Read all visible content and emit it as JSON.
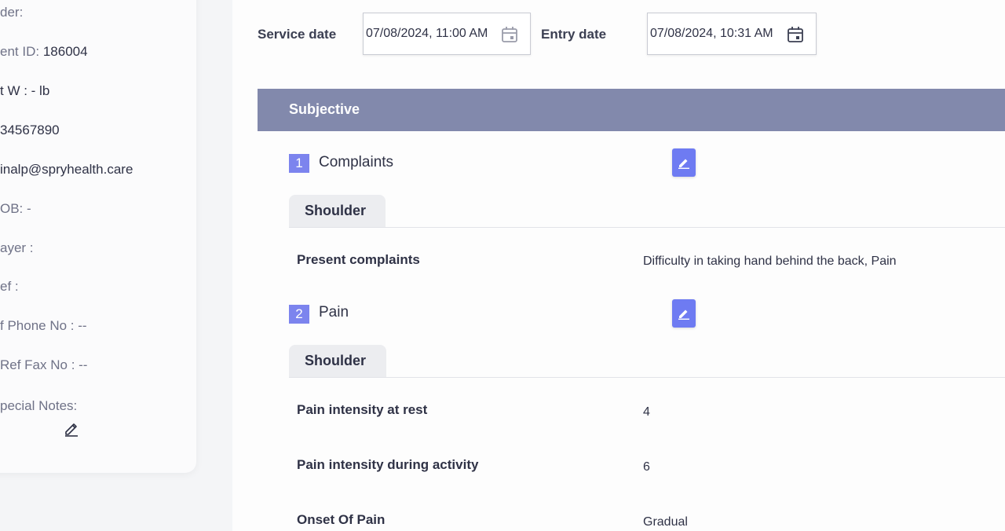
{
  "sidebar": {
    "header": "der:",
    "patient_id_label": "ent ID:",
    "patient_id": "186004",
    "weight": "t W : - lb",
    "phone": "34567890",
    "email": "inalp@spryhealth.care",
    "dob": "OB: -",
    "payer": "ayer :",
    "ref": "ef :",
    "ref_phone": "f Phone No : --",
    "ref_fax": "Ref Fax No : --",
    "special_notes": "pecial Notes:"
  },
  "dates": {
    "service_label": "Service date",
    "service_value": "07/08/2024, 11:00 AM",
    "entry_label": "Entry date",
    "entry_value": "07/08/2024, 10:31 AM"
  },
  "section": {
    "title": "Subjective"
  },
  "items": [
    {
      "number": "1",
      "title": "Complaints",
      "tab": "Shoulder",
      "fields": [
        {
          "label": "Present complaints",
          "value": "Difficulty in taking hand behind the back, Pain"
        }
      ]
    },
    {
      "number": "2",
      "title": "Pain",
      "tab": "Shoulder",
      "fields": [
        {
          "label": "Pain intensity at rest",
          "value": "4"
        },
        {
          "label": "Pain intensity during activity",
          "value": "6"
        },
        {
          "label": "Onset Of Pain",
          "value": "Gradual"
        }
      ]
    }
  ],
  "colors": {
    "section_bar": "#8289ac",
    "accent": "#6e7bf2",
    "badge": "#7c84ee"
  },
  "icons": {
    "calendar": "calendar-icon",
    "edit": "pencil-icon"
  }
}
